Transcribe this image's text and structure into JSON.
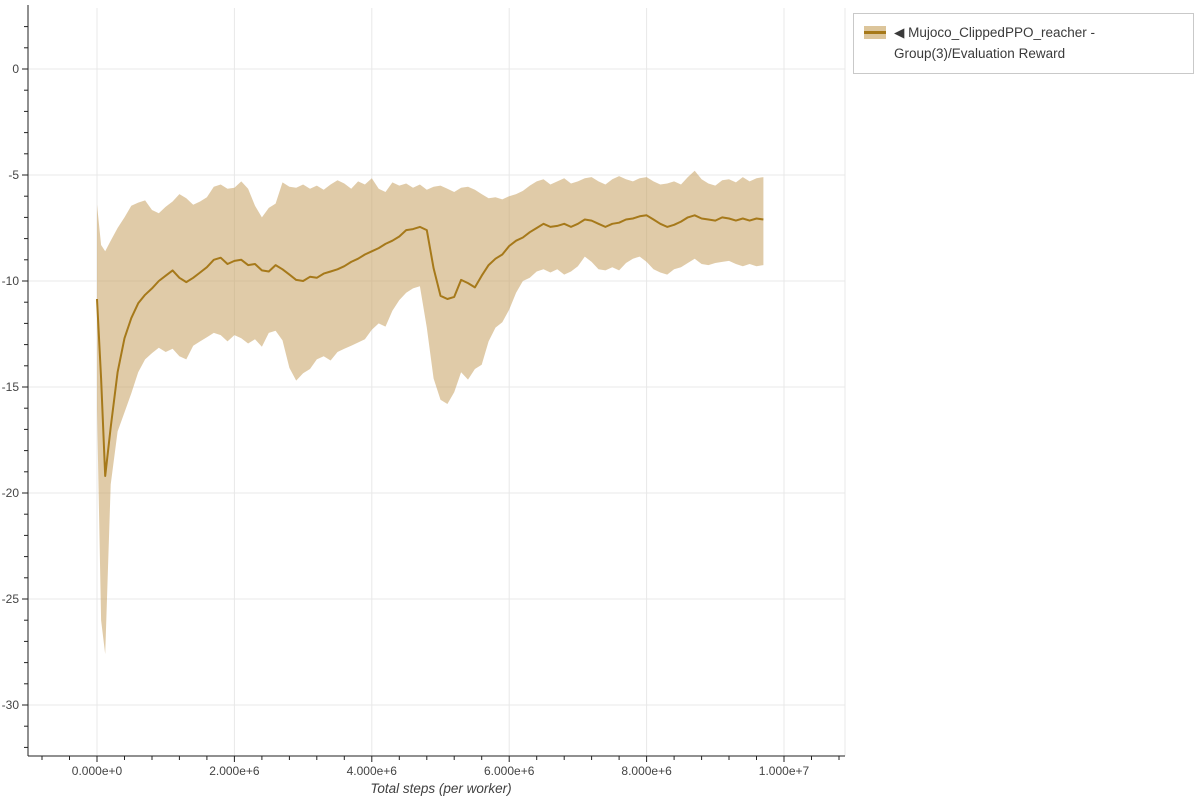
{
  "page": {
    "background": "#ffffff"
  },
  "legend": {
    "label": "◀ Mujoco_ClippedPPO_reacher - Group(3)/Evaluation Reward"
  },
  "chart_data": {
    "type": "line",
    "title": "",
    "xlabel": "Total steps (per worker)",
    "ylabel": "",
    "grid": true,
    "legend_position": "top-right-outside",
    "x_tick_labels": [
      "0.000e+0",
      "2.000e+6",
      "4.000e+6",
      "6.000e+6",
      "8.000e+6",
      "1.000e+7"
    ],
    "x_tick_values_e6": [
      0,
      2,
      4,
      6,
      8,
      10
    ],
    "x_minor_step_e6": 0.4,
    "y_tick_labels": [
      "0",
      "-5",
      "-10",
      "-15",
      "-20",
      "-25",
      "-30"
    ],
    "y_tick_values": [
      0,
      -5,
      -10,
      -15,
      -20,
      -25,
      -30
    ],
    "y_minor_step": 1,
    "xlim_e6": [
      -1.0,
      10.9
    ],
    "ylim": [
      -32.4,
      2.9
    ],
    "colors": {
      "line": "#a6791a",
      "band_fill": "rgba(198,160,97,0.55)",
      "grid": "#e8e8e8",
      "axis": "#222222",
      "tick_label": "#444444"
    },
    "series": [
      {
        "name": "Mujoco_ClippedPPO_reacher - Group(3)/Evaluation Reward",
        "x_e6": [
          0,
          0.06,
          0.12,
          0.2,
          0.3,
          0.4,
          0.5,
          0.6,
          0.7,
          0.8,
          0.9,
          1.0,
          1.1,
          1.2,
          1.3,
          1.4,
          1.5,
          1.6,
          1.7,
          1.8,
          1.9,
          2.0,
          2.1,
          2.2,
          2.3,
          2.4,
          2.5,
          2.6,
          2.7,
          2.8,
          2.9,
          3.0,
          3.1,
          3.2,
          3.3,
          3.4,
          3.5,
          3.6,
          3.7,
          3.8,
          3.9,
          4.0,
          4.1,
          4.2,
          4.3,
          4.4,
          4.5,
          4.6,
          4.7,
          4.8,
          4.9,
          5.0,
          5.1,
          5.2,
          5.3,
          5.4,
          5.5,
          5.6,
          5.7,
          5.8,
          5.9,
          6.0,
          6.1,
          6.2,
          6.3,
          6.4,
          6.5,
          6.6,
          6.7,
          6.8,
          6.9,
          7.0,
          7.1,
          7.2,
          7.3,
          7.4,
          7.5,
          7.6,
          7.7,
          7.8,
          7.9,
          8.0,
          8.1,
          8.2,
          8.3,
          8.4,
          8.5,
          8.6,
          8.7,
          8.8,
          8.9,
          9.0,
          9.1,
          9.2,
          9.3,
          9.4,
          9.5,
          9.6,
          9.7
        ],
        "mean": [
          -10.85,
          -14.6,
          -19.2,
          -16.9,
          -14.3,
          -12.7,
          -11.75,
          -11.05,
          -10.65,
          -10.35,
          -10.0,
          -9.75,
          -9.5,
          -9.85,
          -10.05,
          -9.85,
          -9.6,
          -9.35,
          -9.0,
          -8.9,
          -9.2,
          -9.05,
          -9.0,
          -9.25,
          -9.2,
          -9.5,
          -9.55,
          -9.25,
          -9.45,
          -9.7,
          -9.95,
          -10.0,
          -9.8,
          -9.85,
          -9.65,
          -9.55,
          -9.45,
          -9.3,
          -9.1,
          -8.95,
          -8.75,
          -8.6,
          -8.45,
          -8.25,
          -8.1,
          -7.9,
          -7.6,
          -7.55,
          -7.45,
          -7.6,
          -9.4,
          -10.7,
          -10.85,
          -10.75,
          -9.95,
          -10.1,
          -10.3,
          -9.75,
          -9.25,
          -8.95,
          -8.75,
          -8.35,
          -8.1,
          -7.95,
          -7.7,
          -7.5,
          -7.3,
          -7.45,
          -7.4,
          -7.3,
          -7.45,
          -7.3,
          -7.1,
          -7.15,
          -7.3,
          -7.45,
          -7.3,
          -7.25,
          -7.1,
          -7.05,
          -6.95,
          -6.9,
          -7.1,
          -7.3,
          -7.45,
          -7.35,
          -7.2,
          -7.0,
          -6.9,
          -7.05,
          -7.1,
          -7.15,
          -7.0,
          -7.05,
          -7.15,
          -7.05,
          -7.15,
          -7.05,
          -7.1
        ],
        "upper": [
          -6.4,
          -8.3,
          -8.6,
          -8.1,
          -7.5,
          -7.0,
          -6.45,
          -6.3,
          -6.2,
          -6.65,
          -6.8,
          -6.5,
          -6.25,
          -5.9,
          -6.1,
          -6.4,
          -6.25,
          -6.05,
          -5.55,
          -5.45,
          -5.65,
          -5.6,
          -5.3,
          -5.65,
          -6.45,
          -7.0,
          -6.55,
          -6.35,
          -5.35,
          -5.55,
          -5.6,
          -5.45,
          -5.65,
          -5.5,
          -5.7,
          -5.45,
          -5.25,
          -5.4,
          -5.65,
          -5.3,
          -5.45,
          -5.15,
          -5.65,
          -5.8,
          -5.35,
          -5.5,
          -5.4,
          -5.6,
          -5.45,
          -5.7,
          -5.55,
          -5.5,
          -5.65,
          -5.8,
          -5.6,
          -5.55,
          -5.7,
          -5.9,
          -6.1,
          -6.05,
          -6.15,
          -6.0,
          -5.9,
          -5.75,
          -5.5,
          -5.3,
          -5.2,
          -5.45,
          -5.3,
          -5.15,
          -5.4,
          -5.3,
          -5.15,
          -5.1,
          -5.3,
          -5.45,
          -5.2,
          -5.05,
          -5.2,
          -5.3,
          -5.15,
          -5.1,
          -5.3,
          -5.45,
          -5.4,
          -5.3,
          -5.45,
          -5.1,
          -4.8,
          -5.2,
          -5.4,
          -5.5,
          -5.25,
          -5.2,
          -5.35,
          -5.1,
          -5.3,
          -5.15,
          -5.1
        ],
        "lower": [
          -16.0,
          -26.0,
          -27.6,
          -19.6,
          -17.1,
          -16.2,
          -15.3,
          -14.3,
          -13.7,
          -13.4,
          -13.15,
          -13.35,
          -13.2,
          -13.55,
          -13.7,
          -13.05,
          -12.85,
          -12.65,
          -12.45,
          -12.55,
          -12.85,
          -12.55,
          -12.7,
          -12.95,
          -12.75,
          -13.1,
          -12.45,
          -12.35,
          -12.8,
          -14.1,
          -14.7,
          -14.35,
          -14.15,
          -13.7,
          -13.55,
          -13.75,
          -13.35,
          -13.2,
          -13.05,
          -12.9,
          -12.75,
          -12.3,
          -12.0,
          -12.15,
          -11.4,
          -10.9,
          -10.55,
          -10.35,
          -10.25,
          -12.2,
          -14.6,
          -15.6,
          -15.8,
          -15.25,
          -14.3,
          -14.65,
          -14.15,
          -13.95,
          -12.85,
          -12.2,
          -11.95,
          -11.35,
          -10.55,
          -10.0,
          -9.85,
          -9.55,
          -9.45,
          -9.6,
          -9.45,
          -9.7,
          -9.55,
          -9.3,
          -8.85,
          -9.1,
          -9.45,
          -9.5,
          -9.35,
          -9.5,
          -9.15,
          -8.95,
          -8.85,
          -9.1,
          -9.45,
          -9.6,
          -9.7,
          -9.45,
          -9.35,
          -9.15,
          -8.95,
          -9.2,
          -9.25,
          -9.15,
          -9.1,
          -9.05,
          -9.2,
          -9.3,
          -9.2,
          -9.3,
          -9.25
        ]
      }
    ]
  }
}
